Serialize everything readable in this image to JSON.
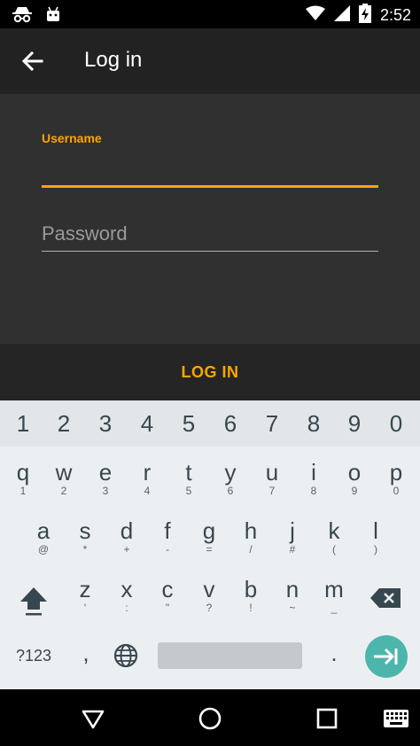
{
  "status_bar": {
    "time": "2:52",
    "icons": [
      "incognito-icon",
      "android-icon",
      "wifi-icon",
      "signal-icon",
      "battery-charging-icon"
    ]
  },
  "app_bar": {
    "title": "Log in",
    "back_icon": "arrow-back-icon"
  },
  "form": {
    "username_label": "Username",
    "username_value": "",
    "password_placeholder": "Password"
  },
  "login_button": "LOG IN",
  "keyboard": {
    "number_row": [
      "1",
      "2",
      "3",
      "4",
      "5",
      "6",
      "7",
      "8",
      "9",
      "0"
    ],
    "row1": [
      {
        "k": "q",
        "s": "1"
      },
      {
        "k": "w",
        "s": "2"
      },
      {
        "k": "e",
        "s": "3"
      },
      {
        "k": "r",
        "s": "4"
      },
      {
        "k": "t",
        "s": "5"
      },
      {
        "k": "y",
        "s": "6"
      },
      {
        "k": "u",
        "s": "7"
      },
      {
        "k": "i",
        "s": "8"
      },
      {
        "k": "o",
        "s": "9"
      },
      {
        "k": "p",
        "s": "0"
      }
    ],
    "row2": [
      {
        "k": "a",
        "s": "@"
      },
      {
        "k": "s",
        "s": "*"
      },
      {
        "k": "d",
        "s": "+"
      },
      {
        "k": "f",
        "s": "-"
      },
      {
        "k": "g",
        "s": "="
      },
      {
        "k": "h",
        "s": "/"
      },
      {
        "k": "j",
        "s": "#"
      },
      {
        "k": "k",
        "s": "("
      },
      {
        "k": "l",
        "s": ")"
      }
    ],
    "row3": [
      {
        "k": "z",
        "s": "'"
      },
      {
        "k": "x",
        "s": ":"
      },
      {
        "k": "c",
        "s": "\""
      },
      {
        "k": "v",
        "s": "?"
      },
      {
        "k": "b",
        "s": "!"
      },
      {
        "k": "n",
        "s": "~"
      },
      {
        "k": "m",
        "s": "_"
      }
    ],
    "symbols_key": "?123",
    "comma_key": ",",
    "period_key": ".",
    "shift_icon": "shift-icon",
    "delete_icon": "backspace-icon",
    "globe_icon": "globe-icon",
    "enter_icon": "next-arrow-icon"
  },
  "nav_bar": {
    "icons": [
      "back-triangle-icon",
      "home-circle-icon",
      "recents-square-icon",
      "keyboard-switch-icon"
    ]
  },
  "colors": {
    "accent": "#FFA500",
    "app_bar": "#222222",
    "form_bg": "#303030",
    "keyboard_bg": "#eceff1",
    "enter_key": "#4db6ac"
  }
}
